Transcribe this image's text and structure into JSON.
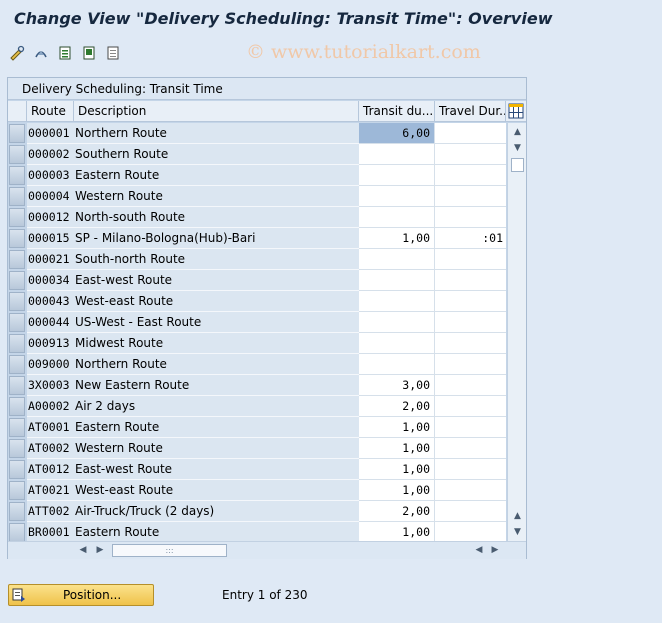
{
  "window": {
    "title": "Change View \"Delivery Scheduling: Transit Time\": Overview"
  },
  "toolbar": {
    "icons": [
      "edit-glasses-icon",
      "change-display-icon",
      "select-all-icon",
      "select-block-icon",
      "deselect-all-icon"
    ]
  },
  "watermark": "© www.tutorialkart.com",
  "table": {
    "caption": "Delivery Scheduling: Transit Time",
    "columns": {
      "route": "Route",
      "description": "Description",
      "transit": "Transit du...",
      "travel": "Travel Dur..."
    },
    "rows": [
      {
        "route": "000001",
        "description": "Northern Route",
        "transit": "6,00",
        "travel": "",
        "active": true
      },
      {
        "route": "000002",
        "description": "Southern Route",
        "transit": "",
        "travel": ""
      },
      {
        "route": "000003",
        "description": "Eastern Route",
        "transit": "",
        "travel": ""
      },
      {
        "route": "000004",
        "description": "Western Route",
        "transit": "",
        "travel": ""
      },
      {
        "route": "000012",
        "description": "North-south Route",
        "transit": "",
        "travel": ""
      },
      {
        "route": "000015",
        "description": "SP - Milano-Bologna(Hub)-Bari",
        "transit": "1,00",
        "travel": ":01"
      },
      {
        "route": "000021",
        "description": "South-north Route",
        "transit": "",
        "travel": ""
      },
      {
        "route": "000034",
        "description": "East-west Route",
        "transit": "",
        "travel": ""
      },
      {
        "route": "000043",
        "description": "West-east Route",
        "transit": "",
        "travel": ""
      },
      {
        "route": "000044",
        "description": "US-West - East Route",
        "transit": "",
        "travel": ""
      },
      {
        "route": "000913",
        "description": "Midwest Route",
        "transit": "",
        "travel": ""
      },
      {
        "route": "009000",
        "description": "Northern Route",
        "transit": "",
        "travel": ""
      },
      {
        "route": "3X0003",
        "description": "New Eastern Route",
        "transit": "3,00",
        "travel": ""
      },
      {
        "route": "A00002",
        "description": "Air 2 days",
        "transit": "2,00",
        "travel": ""
      },
      {
        "route": "AT0001",
        "description": "Eastern Route",
        "transit": "1,00",
        "travel": ""
      },
      {
        "route": "AT0002",
        "description": "Western Route",
        "transit": "1,00",
        "travel": ""
      },
      {
        "route": "AT0012",
        "description": "East-west Route",
        "transit": "1,00",
        "travel": ""
      },
      {
        "route": "AT0021",
        "description": "West-east Route",
        "transit": "1,00",
        "travel": ""
      },
      {
        "route": "ATT002",
        "description": "Air-Truck/Truck (2 days)",
        "transit": "2,00",
        "travel": ""
      },
      {
        "route": "BR0001",
        "description": "Eastern Route",
        "transit": "1,00",
        "travel": ""
      }
    ]
  },
  "footer": {
    "position_button": "Position...",
    "entry_info": "Entry 1 of 230"
  }
}
